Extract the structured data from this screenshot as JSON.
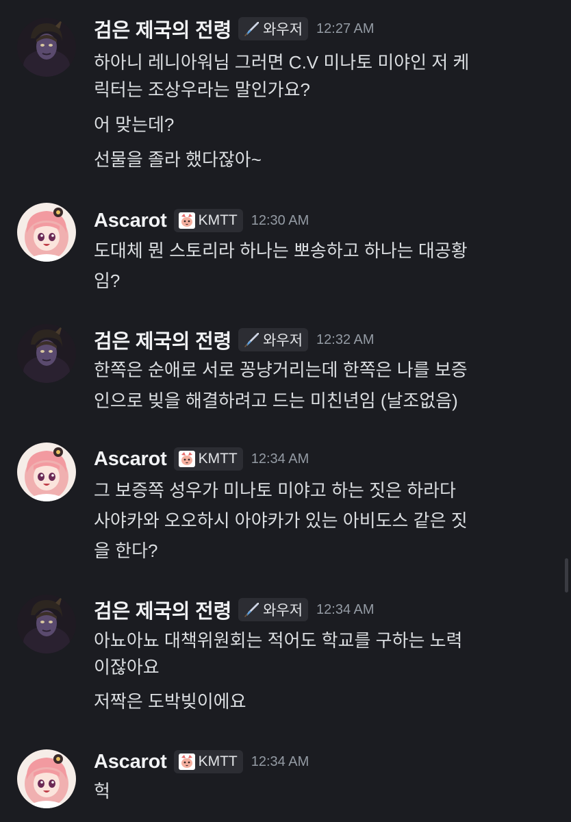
{
  "messages": [
    {
      "author": "검은 제국의 전령",
      "tag": "와우저",
      "tag_icon": "sword-icon",
      "time": "12:27 AM",
      "lines": [
        "하아니 레니아워님 그러면 C.V 미나토 미야인 저 케",
        "릭터는 조상우라는 말인가요?",
        "어 맞는데?",
        "선물을 졸라 했다잖아~"
      ]
    },
    {
      "author": "Ascarot",
      "tag": "KMTT",
      "tag_icon": "cat-face-icon",
      "time": "12:30 AM",
      "lines": [
        "도대체 뭔 스토리라 하나는 뽀송하고 하나는 대공황",
        "임?"
      ]
    },
    {
      "author": "검은 제국의 전령",
      "tag": "와우저",
      "tag_icon": "sword-icon",
      "time": "12:32 AM",
      "lines": [
        "한쪽은 순애로 서로 꽁냥거리는데 한쪽은 나를 보증",
        "인으로 빚을 해결하려고 드는 미친년임 (날조없음)"
      ]
    },
    {
      "author": "Ascarot",
      "tag": "KMTT",
      "tag_icon": "cat-face-icon",
      "time": "12:34 AM",
      "lines": [
        "그 보증쪽 성우가 미나토 미야고 하는 짓은 하라다",
        "사야카와 오오하시 아야카가 있는 아비도스 같은 짓",
        "을 한다?"
      ]
    },
    {
      "author": "검은 제국의 전령",
      "tag": "와우저",
      "tag_icon": "sword-icon",
      "time": "12:34 AM",
      "lines": [
        "아뇨아뇨 대책위원회는 적어도 학교를 구하는 노력",
        "이잖아요",
        "저짝은 도박빚이에요"
      ]
    },
    {
      "author": "Ascarot",
      "tag": "KMTT",
      "tag_icon": "cat-face-icon",
      "time": "12:34 AM",
      "lines": [
        "헉"
      ]
    }
  ],
  "colors": {
    "background": "#1b1c21",
    "username": "#f2f3f5",
    "message_text": "#dbdee1",
    "timestamp": "#949ba4",
    "tag_background": "#2c2d33"
  }
}
